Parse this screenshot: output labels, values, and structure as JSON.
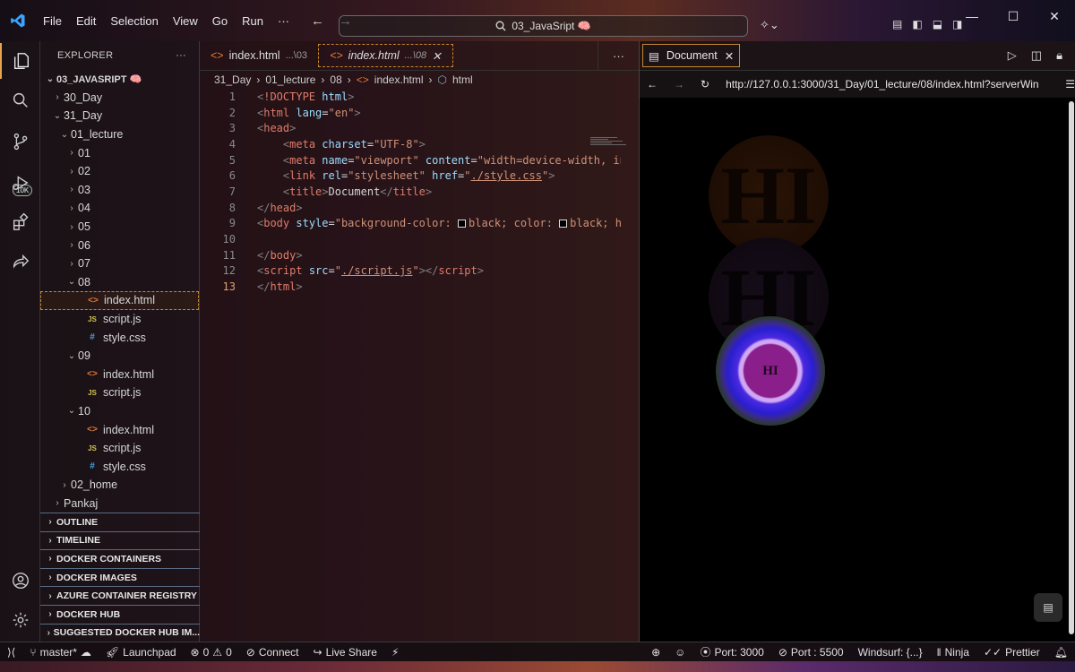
{
  "window": {
    "menu": [
      "File",
      "Edit",
      "Selection",
      "View",
      "Go",
      "Run",
      "···"
    ],
    "search_text": "03_JavaSript 🧠",
    "controls": [
      "—",
      "☐",
      "✕"
    ]
  },
  "activity": {
    "items": [
      "explorer-icon",
      "search-icon",
      "source-control-icon",
      "run-debug-icon",
      "extensions-icon",
      "live-share-icon"
    ],
    "badge": "10K",
    "bottom": [
      "account-icon",
      "settings-gear-icon"
    ]
  },
  "sidebar": {
    "title": "EXPLORER",
    "more": "···",
    "tree": [
      {
        "label": "03_JAVASRIPT 🧠",
        "depth": 0,
        "chev": "⌄",
        "icon": "",
        "kind": "root"
      },
      {
        "label": "30_Day",
        "depth": 1,
        "chev": "›",
        "icon": "",
        "kind": "folder"
      },
      {
        "label": "31_Day",
        "depth": 1,
        "chev": "⌄",
        "icon": "",
        "kind": "folder"
      },
      {
        "label": "01_lecture",
        "depth": 2,
        "chev": "⌄",
        "icon": "",
        "kind": "folder"
      },
      {
        "label": "01",
        "depth": 3,
        "chev": "›",
        "icon": "",
        "kind": "folder"
      },
      {
        "label": "02",
        "depth": 3,
        "chev": "›",
        "icon": "",
        "kind": "folder"
      },
      {
        "label": "03",
        "depth": 3,
        "chev": "›",
        "icon": "",
        "kind": "folder"
      },
      {
        "label": "04",
        "depth": 3,
        "chev": "›",
        "icon": "",
        "kind": "folder"
      },
      {
        "label": "05",
        "depth": 3,
        "chev": "›",
        "icon": "",
        "kind": "folder"
      },
      {
        "label": "06",
        "depth": 3,
        "chev": "›",
        "icon": "",
        "kind": "folder"
      },
      {
        "label": "07",
        "depth": 3,
        "chev": "›",
        "icon": "",
        "kind": "folder"
      },
      {
        "label": "08",
        "depth": 3,
        "chev": "⌄",
        "icon": "",
        "kind": "folder"
      },
      {
        "label": "index.html",
        "depth": 4,
        "chev": "",
        "icon": "<>",
        "kind": "html",
        "selected": true
      },
      {
        "label": "script.js",
        "depth": 4,
        "chev": "",
        "icon": "JS",
        "kind": "js"
      },
      {
        "label": "style.css",
        "depth": 4,
        "chev": "",
        "icon": "#",
        "kind": "css"
      },
      {
        "label": "09",
        "depth": 3,
        "chev": "⌄",
        "icon": "",
        "kind": "folder"
      },
      {
        "label": "index.html",
        "depth": 4,
        "chev": "",
        "icon": "<>",
        "kind": "html"
      },
      {
        "label": "script.js",
        "depth": 4,
        "chev": "",
        "icon": "JS",
        "kind": "js"
      },
      {
        "label": "10",
        "depth": 3,
        "chev": "⌄",
        "icon": "",
        "kind": "folder"
      },
      {
        "label": "index.html",
        "depth": 4,
        "chev": "",
        "icon": "<>",
        "kind": "html"
      },
      {
        "label": "script.js",
        "depth": 4,
        "chev": "",
        "icon": "JS",
        "kind": "js"
      },
      {
        "label": "style.css",
        "depth": 4,
        "chev": "",
        "icon": "#",
        "kind": "css"
      },
      {
        "label": "02_home",
        "depth": 2,
        "chev": "›",
        "icon": "",
        "kind": "folder"
      },
      {
        "label": "Pankaj",
        "depth": 1,
        "chev": "›",
        "icon": "",
        "kind": "folder"
      }
    ],
    "panels": [
      "OUTLINE",
      "TIMELINE",
      "DOCKER CONTAINERS",
      "DOCKER IMAGES",
      "AZURE CONTAINER REGISTRY",
      "DOCKER HUB",
      "SUGGESTED DOCKER HUB IM..."
    ]
  },
  "editor": {
    "tabs": [
      {
        "label": "index.html",
        "path": "...\\03",
        "active": false
      },
      {
        "label": "index.html",
        "path": "...\\08",
        "active": true
      }
    ],
    "tab_more": "···",
    "breadcrumb": [
      "31_Day",
      "01_lecture",
      "08",
      "index.html",
      "html"
    ],
    "lines": [
      {
        "n": "1",
        "html": "<span class='t-gray'>&lt;</span><span class='t-tag'>!DOCTYPE</span> <span class='t-attr'>html</span><span class='t-gray'>&gt;</span>"
      },
      {
        "n": "2",
        "html": "<span class='t-gray'>&lt;</span><span class='t-tag'>html</span> <span class='t-attr'>lang</span>=<span class='t-str'>\"en\"</span><span class='t-gray'>&gt;</span>"
      },
      {
        "n": "3",
        "html": "<span class='t-gray'>&lt;</span><span class='t-tag'>head</span><span class='t-gray'>&gt;</span>"
      },
      {
        "n": "4",
        "html": "    <span class='t-gray'>&lt;</span><span class='t-tag'>meta</span> <span class='t-attr'>charset</span>=<span class='t-str'>\"UTF-8\"</span><span class='t-gray'>&gt;</span>"
      },
      {
        "n": "5",
        "html": "    <span class='t-gray'>&lt;</span><span class='t-tag'>meta</span> <span class='t-attr'>name</span>=<span class='t-str'>\"viewport\"</span> <span class='t-attr'>content</span>=<span class='t-str'>\"width=device-width, init</span>"
      },
      {
        "n": "6",
        "html": "    <span class='t-gray'>&lt;</span><span class='t-tag'>link</span> <span class='t-attr'>rel</span>=<span class='t-str'>\"stylesheet\"</span> <span class='t-attr'>href</span>=<span class='t-str'>\"<u>./style.css</u>\"</span><span class='t-gray'>&gt;</span>"
      },
      {
        "n": "7",
        "html": "    <span class='t-gray'>&lt;</span><span class='t-tag'>title</span><span class='t-gray'>&gt;</span><span class='t-txt'>Document</span><span class='t-gray'>&lt;/</span><span class='t-tag'>title</span><span class='t-gray'>&gt;</span>"
      },
      {
        "n": "8",
        "html": "<span class='t-gray'>&lt;/</span><span class='t-tag'>head</span><span class='t-gray'>&gt;</span>"
      },
      {
        "n": "9",
        "html": "<span class='t-gray'>&lt;</span><span class='t-tag'>body</span> <span class='t-attr'>style</span>=<span class='t-str'>\"background-color: <span class='swatch'></span>black; color: <span class='swatch'></span>black; he</span>"
      },
      {
        "n": "10",
        "html": ""
      },
      {
        "n": "11",
        "html": "<span class='t-gray'>&lt;/</span><span class='t-tag'>body</span><span class='t-gray'>&gt;</span>"
      },
      {
        "n": "12",
        "html": "<span class='t-gray'>&lt;</span><span class='t-tag'>script</span> <span class='t-attr'>src</span>=<span class='t-str'>\"<u>./script.js</u>\"</span><span class='t-gray'>&gt;&lt;/</span><span class='t-tag'>script</span><span class='t-gray'>&gt;</span>"
      },
      {
        "n": "13",
        "html": "<span class='t-gray'>&lt;/</span><span class='t-tag'>html</span><span class='t-gray'>&gt;</span>",
        "current": true
      }
    ]
  },
  "browser": {
    "tab_label": "Document",
    "url": "http://127.0.0.1:3000/31_Day/01_lecture/08/index.html?serverWin",
    "circle_text": "HI"
  },
  "status": {
    "left": [
      "master*",
      "Launchpad",
      "0",
      "0",
      "Connect",
      "Live Share"
    ],
    "right": [
      "Port: 3000",
      "Port : 5500",
      "Windsurf: {...}",
      "Ninja",
      "Prettier"
    ]
  }
}
